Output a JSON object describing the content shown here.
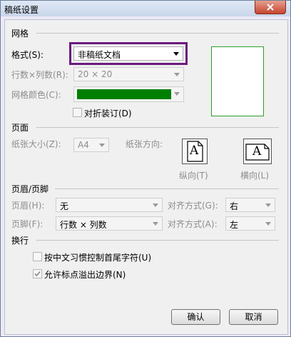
{
  "window": {
    "title": "稿纸设置"
  },
  "grid": {
    "section": "网格",
    "format_label": "格式(S):",
    "format_value": "非稿纸文档",
    "rows_cols_label": "行数×列数(R):",
    "rows_cols_value": "20 × 20",
    "grid_color_label": "网格颜色(C):",
    "grid_color": "#008000",
    "highlight_color": "#6a1b7d",
    "preview_border_color": "#2e9e2e",
    "fold_label": "对折装订(D)",
    "fold_checked": false
  },
  "page": {
    "section": "页面",
    "size_label": "纸张大小(Z):",
    "size_value": "A4",
    "orientation_label": "纸张方向:",
    "portrait_label": "纵向(T)",
    "landscape_label": "横向(L)",
    "orient_icon_letter": "A"
  },
  "header_footer": {
    "section": "页眉/页脚",
    "header_label": "页眉(H):",
    "header_value": "无",
    "header_align_label": "对齐方式(G):",
    "header_align_value": "右",
    "footer_label": "页脚(F):",
    "footer_value": "行数 × 列数",
    "footer_align_label": "对齐方式(A):",
    "footer_align_value": "左"
  },
  "line_break": {
    "section": "换行",
    "opt1_label": "按中文习惯控制首尾字符(U)",
    "opt1_checked": false,
    "opt2_label": "允许标点溢出边界(N)",
    "opt2_checked": true
  },
  "buttons": {
    "ok": "确认",
    "cancel": "取消"
  }
}
